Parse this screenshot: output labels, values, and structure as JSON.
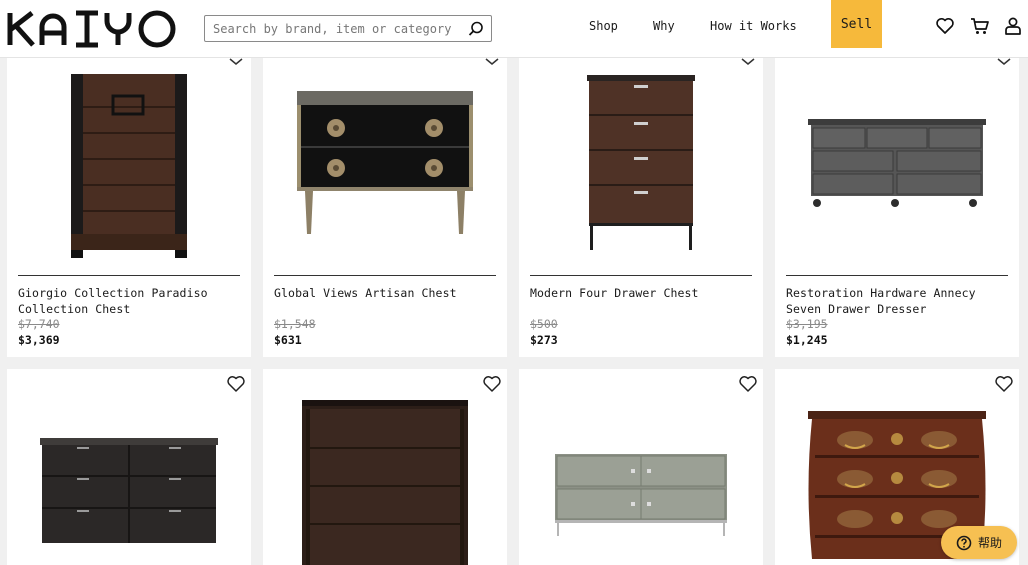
{
  "header": {
    "logo_text": "KAIYO",
    "search_placeholder": "Search by brand, item or category",
    "nav": {
      "shop": "Shop",
      "why": "Why",
      "how": "How it Works"
    },
    "sell_label": "Sell",
    "icons": [
      "heart-icon",
      "cart-icon",
      "user-icon"
    ]
  },
  "products_row1": [
    {
      "name": "Giorgio Collection Paradiso Collection Chest",
      "original_price": "$7,740",
      "price": "$3,369"
    },
    {
      "name": "Global Views Artisan Chest",
      "original_price": "$1,548",
      "price": "$631"
    },
    {
      "name": "Modern Four Drawer Chest",
      "original_price": "$500",
      "price": "$273"
    },
    {
      "name": "Restoration Hardware Annecy Seven Drawer Dresser",
      "original_price": "$3,195",
      "price": "$1,245"
    }
  ],
  "help_button": {
    "label": "帮助"
  },
  "colors": {
    "accent": "#f6b93b",
    "background": "#f0f0f0",
    "text": "#111111"
  }
}
